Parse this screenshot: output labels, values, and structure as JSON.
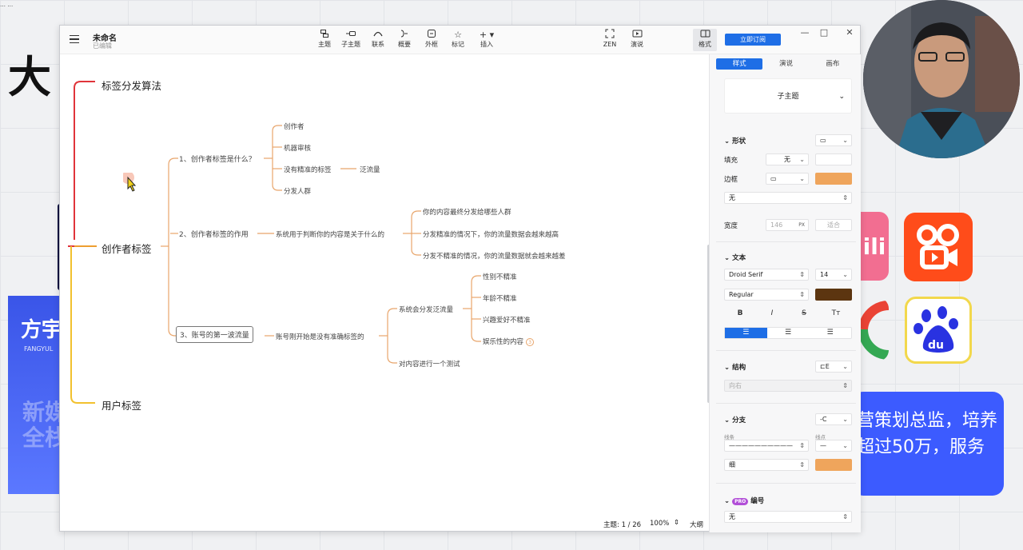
{
  "background": {
    "big_char": "大",
    "left_card": {
      "title": "方宇",
      "sub": "FANGYUL",
      "faded": "新媒\n全栈"
    },
    "right_card_text": "营策划总监，培养\n超过50万，服务",
    "top_left_text": "…\n…"
  },
  "window": {
    "doc_title": "未命名",
    "doc_status": "已编辑",
    "subscribe_label": "立即订阅",
    "controls": {
      "minimize": "—",
      "maximize": "□",
      "close": "✕"
    },
    "toolbar": [
      {
        "name": "topic",
        "label": "主题",
        "icon": "topic-icon"
      },
      {
        "name": "subtopic",
        "label": "子主题",
        "icon": "subtopic-icon"
      },
      {
        "name": "relation",
        "label": "联系",
        "icon": "relation-icon"
      },
      {
        "name": "summary",
        "label": "概要",
        "icon": "summary-icon"
      },
      {
        "name": "boundary",
        "label": "外框",
        "icon": "boundary-icon"
      },
      {
        "name": "marker",
        "label": "标记",
        "icon": "star-icon"
      },
      {
        "name": "insert",
        "label": "插入",
        "icon": "plus-icon"
      },
      {
        "name": "zen",
        "label": "ZEN",
        "icon": "zen-icon"
      },
      {
        "name": "present",
        "label": "演说",
        "icon": "present-icon"
      },
      {
        "name": "format",
        "label": "格式",
        "icon": "format-panel-icon"
      }
    ]
  },
  "mindmap": {
    "main_topics": [
      "标签分发算法",
      "创作者标签",
      "用户标签"
    ],
    "b1": {
      "label": "1、创作者标签是什么？",
      "leaves": [
        "创作者",
        "机器审核",
        "没有精准的标签",
        "分发人群"
      ],
      "leaf_extra": "泛流量"
    },
    "b2": {
      "label": "2、创作者标签的作用",
      "mid": "系统用于判断你的内容是关于什么的",
      "leaves": [
        "你的内容最终分发给哪些人群",
        "分发精准的情况下，你的流量数据会越来越高",
        "分发不精准的情况，你的流量数据就会越来越差"
      ]
    },
    "b3": {
      "label": "3、账号的第一波流量",
      "mid": "账号刚开始是没有准确标签的",
      "c1": "系统会分发泛流量",
      "c1_leaves": [
        "性别不精准",
        "年龄不精准",
        "兴趣爱好不精准",
        "娱乐性的内容"
      ],
      "badge": "3",
      "c2": "对内容进行一个测试"
    }
  },
  "status": {
    "topic_count": "主题: 1 / 26",
    "zoom": "100%",
    "outline": "大纲"
  },
  "panel": {
    "tabs": [
      "样式",
      "演说",
      "画布"
    ],
    "topic_style": "子主题",
    "shape": {
      "title": "形状",
      "fill_label": "填充",
      "fill_value": "无",
      "border_label": "边框",
      "border_color": "#efa55c",
      "line_value": "无",
      "width_label": "宽度",
      "width_value": "146",
      "width_unit": "PX",
      "fit_label": "适合"
    },
    "text": {
      "title": "文本",
      "font": "Droid Serif",
      "size": "14",
      "weight": "Regular",
      "color": "#5c3510",
      "styles": [
        "B",
        "I",
        "S",
        "Tт"
      ]
    },
    "structure": {
      "title": "结构",
      "direction": "向右"
    },
    "branch": {
      "title": "分支",
      "line_label": "线条",
      "end_label": "线点",
      "thickness": "细",
      "color": "#efa55c"
    },
    "numbering": {
      "pro": "PRO",
      "title": "编号",
      "value": "无"
    }
  },
  "colors": {
    "accent": "#1e6ee6",
    "branch_red": "#e0343a",
    "branch_yellow": "#f2c12e",
    "branch_orange": "#e8a56b"
  }
}
